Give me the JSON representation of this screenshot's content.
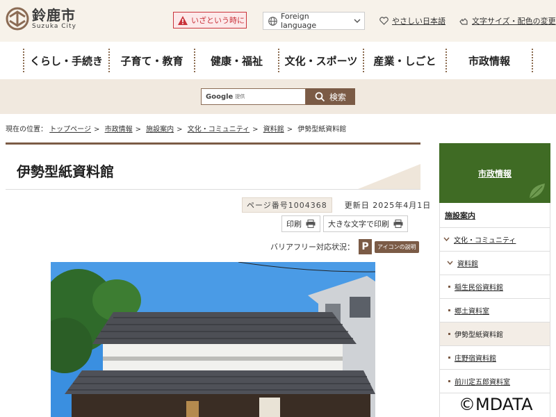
{
  "header": {
    "logo_jp": "鈴鹿市",
    "logo_en": "Suzuka City",
    "emergency_label": "いざという時に",
    "language_label": "Foreign language",
    "easy_japanese_label": "やさしい日本語",
    "font_color_label": "文字サイズ・配色の変更"
  },
  "global_nav": [
    "くらし・手続き",
    "子育て・教育",
    "健康・福祉",
    "文化・スポーツ",
    "産業・しごと",
    "市政情報"
  ],
  "search": {
    "input_brand": "Google",
    "input_sub": "提供",
    "button_label": "検索"
  },
  "breadcrumb": {
    "prefix": "現在の位置：",
    "items": [
      "トップページ",
      "市政情報",
      "施設案内",
      "文化・コミュニティ",
      "資料館"
    ],
    "current": "伊勢型紙資料館",
    "separator": ">"
  },
  "page": {
    "title": "伊勢型紙資料館",
    "page_number": "ページ番号1004368",
    "updated": "更新日 2025年4月1日",
    "print_label": "印刷",
    "print_large_label": "大きな文字で印刷",
    "barrier_free_label": "バリアフリー対応状況：",
    "barrier_free_icon_letter": "P",
    "icon_desc_label": "アイコンの説明"
  },
  "sidebar": {
    "heading": "市政情報",
    "items": [
      {
        "label": "施設案内",
        "level": 0
      },
      {
        "label": "文化・コミュニティ",
        "level": 1
      },
      {
        "label": "資料館",
        "level": 2
      },
      {
        "label": "稲生民俗資料館",
        "level": 3
      },
      {
        "label": "郷土資料室",
        "level": 3
      },
      {
        "label": "伊勢型紙資料館",
        "level": 3,
        "current": true
      },
      {
        "label": "庄野宿資料館",
        "level": 3
      },
      {
        "label": "前川定五郎資料室",
        "level": 3
      }
    ]
  },
  "watermark": "©MDATA",
  "colors": {
    "brand_brown": "#7b5b46",
    "sidebar_green": "#3f6b24",
    "emergency_red": "#c9323a",
    "header_bg": "#f7f2ea"
  }
}
